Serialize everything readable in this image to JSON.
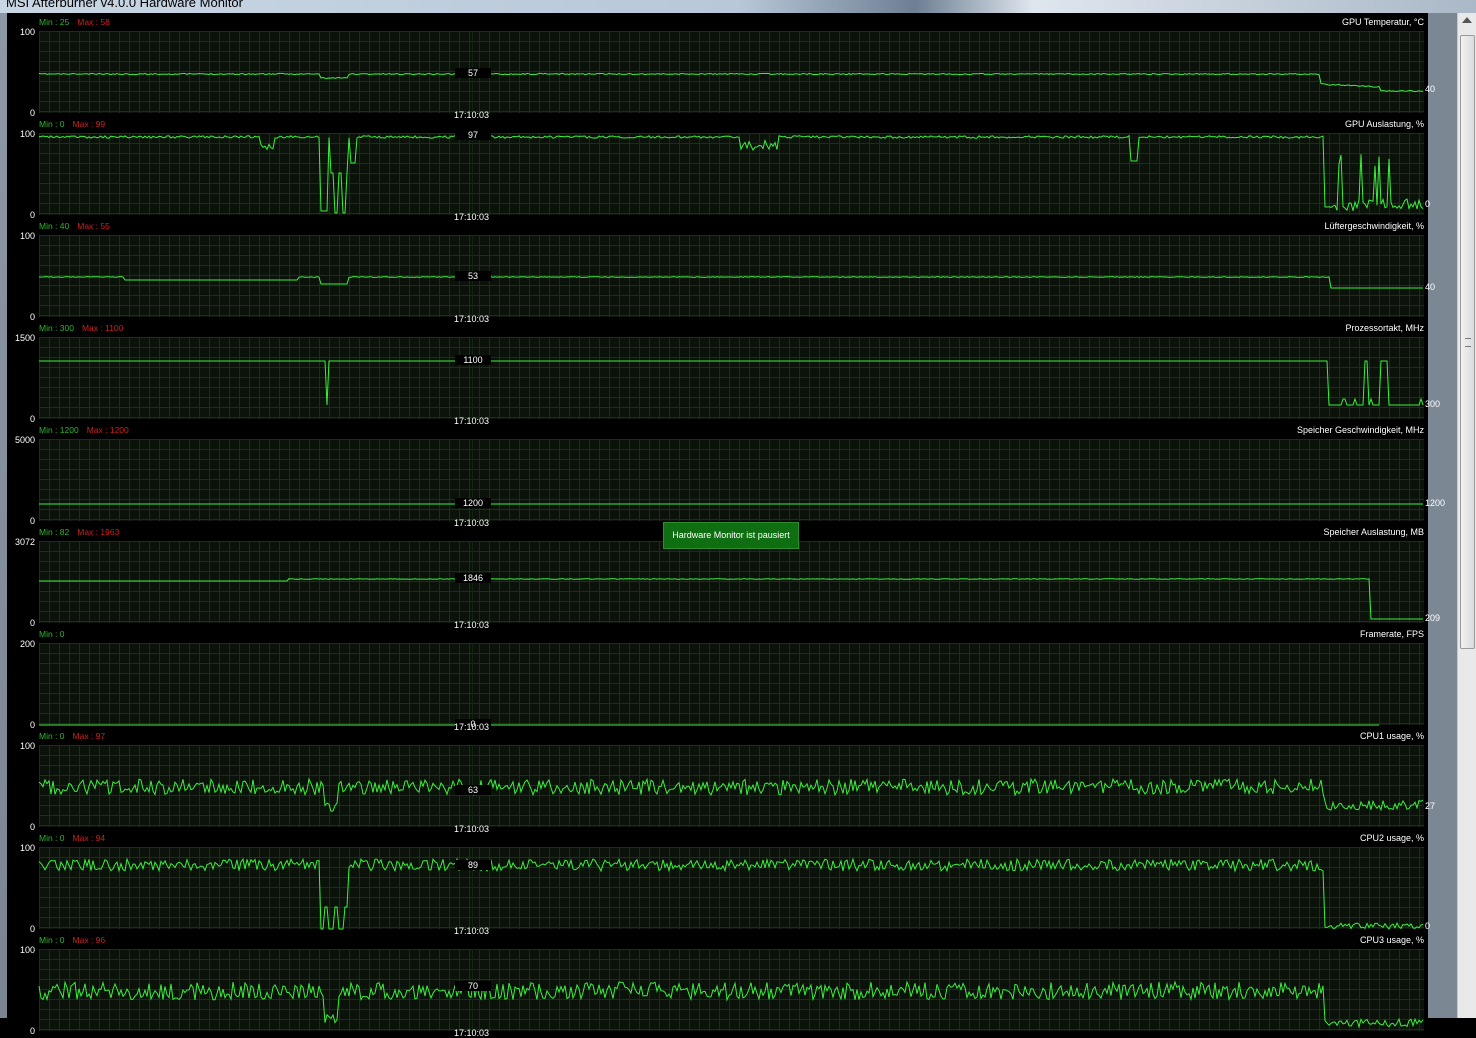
{
  "window": {
    "title": "MSI Afterburner v4.0.0 Hardware Monitor"
  },
  "colors": {
    "trace": "#3cf03c",
    "min_label": "#2fb52f",
    "max_label": "#d11f1f",
    "grid": "#143214",
    "overlay": "#0f6e12"
  },
  "overlay": {
    "text": "Hardware Monitor ist pausiert"
  },
  "panels": [
    {
      "title": "GPU Temperatur, °C",
      "min_label": "Min : 25",
      "max_label": "Max : 58",
      "y_max": "100",
      "y_min": "0",
      "cursor_value": "57",
      "cursor_time": "17:10:03",
      "current_value": "40",
      "shape": "temp"
    },
    {
      "title": "GPU Auslastung, %",
      "min_label": "Min : 0",
      "max_label": "Max : 99",
      "y_max": "100",
      "y_min": "0",
      "cursor_value": "97",
      "cursor_time": "17:10:03",
      "current_value": "0",
      "shape": "gpuload"
    },
    {
      "title": "Lüftergeschwindigkeit, %",
      "min_label": "Min : 40",
      "max_label": "Max : 55",
      "y_max": "100",
      "y_min": "0",
      "cursor_value": "53",
      "cursor_time": "17:10:03",
      "current_value": "40",
      "shape": "fan"
    },
    {
      "title": "Prozessortakt, MHz",
      "min_label": "Min : 300",
      "max_label": "Max : 1100",
      "y_max": "1500",
      "y_min": "0",
      "cursor_value": "1100",
      "cursor_time": "17:10:03",
      "current_value": "300",
      "shape": "clock"
    },
    {
      "title": "Speicher Geschwindigkeit, MHz",
      "min_label": "Min : 1200",
      "max_label": "Max : 1200",
      "y_max": "5000",
      "y_min": "0",
      "cursor_value": "1200",
      "cursor_time": "17:10:03",
      "current_value": "1200",
      "shape": "memclock"
    },
    {
      "title": "Speicher Auslastung, MB",
      "min_label": "Min : 82",
      "max_label": "Max : 1963",
      "y_max": "3072",
      "y_min": "0",
      "cursor_value": "1846",
      "cursor_time": "17:10:03",
      "current_value": "209",
      "shape": "memuse"
    },
    {
      "title": "Framerate, FPS",
      "min_label": "Min : 0",
      "max_label": "",
      "y_max": "200",
      "y_min": "0",
      "cursor_value": "0",
      "cursor_time": "17:10:03",
      "current_value": "",
      "shape": "fps"
    },
    {
      "title": "CPU1 usage, %",
      "min_label": "Min : 0",
      "max_label": "Max : 97",
      "y_max": "100",
      "y_min": "0",
      "cursor_value": "63",
      "cursor_time": "17:10:03",
      "current_value": "27",
      "shape": "cpu1"
    },
    {
      "title": "CPU2 usage, %",
      "min_label": "Min : 0",
      "max_label": "Max : 94",
      "y_max": "100",
      "y_min": "0",
      "cursor_value": "89",
      "cursor_time": "17:10:03",
      "current_value": "0",
      "shape": "cpu2"
    },
    {
      "title": "CPU3 usage, %",
      "min_label": "Min : 0",
      "max_label": "Max : 96",
      "y_max": "100",
      "y_min": "0",
      "cursor_value": "70",
      "cursor_time": "17:10:03",
      "current_value": "",
      "shape": "cpu3"
    }
  ]
}
